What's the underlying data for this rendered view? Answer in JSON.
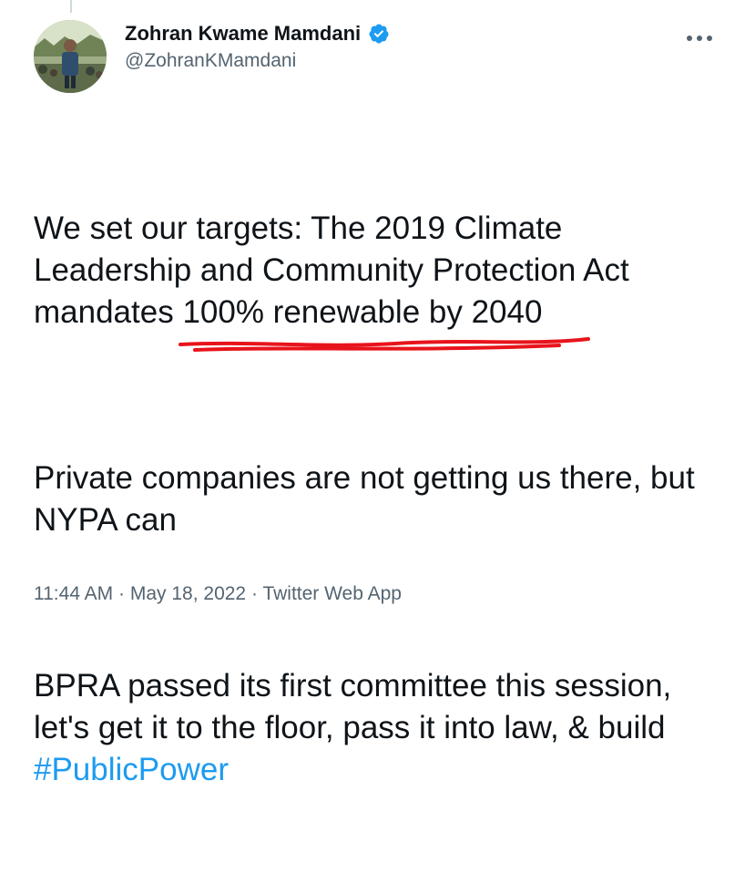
{
  "author": {
    "display_name": "Zohran Kwame Mamdani",
    "handle": "@ZohranKMamdani",
    "verified": true,
    "avatar_icon": "profile-photo"
  },
  "tweet": {
    "p1_before": "We set our targets: The 2019 Climate Leadership and Community Protection Act mandates ",
    "p1_highlight": "100% renewable by 2040",
    "p2": "Private companies are not getting us there, but NYPA can",
    "p3_before": "BPRA passed its first committee this session, let's get it to the floor, pass it into law, & build ",
    "hashtag": "#PublicPower"
  },
  "meta": {
    "time": "11:44 AM",
    "separator": "·",
    "date": "May 18, 2022",
    "source": "Twitter Web App"
  },
  "colors": {
    "text": "#0f1419",
    "secondary": "#536471",
    "link": "#1d9bf0",
    "verified": "#1d9bf0",
    "annotation": "#e8141b"
  },
  "icons": {
    "verified": "verified-badge-icon",
    "more": "more-options-icon"
  }
}
